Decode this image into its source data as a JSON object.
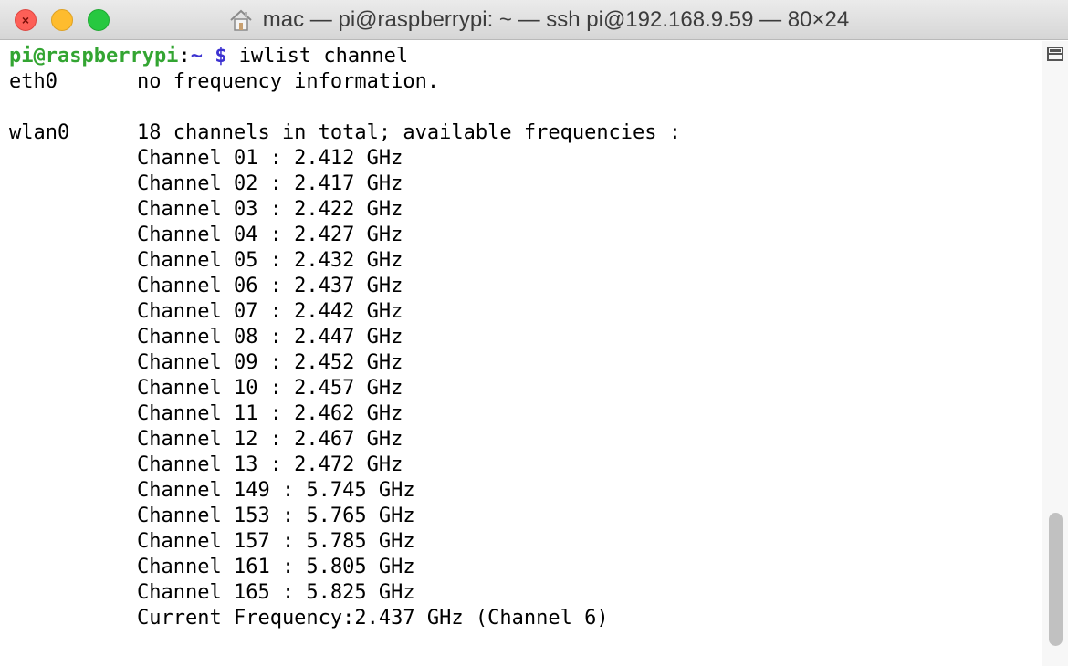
{
  "window": {
    "title": "mac — pi@raspberrypi: ~ — ssh pi@192.168.9.59 — 80×24",
    "buttons": [
      "close",
      "minimize",
      "zoom"
    ],
    "title_icon": "home-icon"
  },
  "prompt": {
    "user_host": "pi@raspberrypi",
    "separator": ":",
    "path": "~",
    "symbol": "$",
    "command": "iwlist channel"
  },
  "output": {
    "eth0": {
      "iface": "eth0",
      "message": "no frequency information."
    },
    "wlan0": {
      "iface": "wlan0",
      "summary": "18 channels in total; available frequencies :"
    },
    "channels": [
      "Channel 01 : 2.412 GHz",
      "Channel 02 : 2.417 GHz",
      "Channel 03 : 2.422 GHz",
      "Channel 04 : 2.427 GHz",
      "Channel 05 : 2.432 GHz",
      "Channel 06 : 2.437 GHz",
      "Channel 07 : 2.442 GHz",
      "Channel 08 : 2.447 GHz",
      "Channel 09 : 2.452 GHz",
      "Channel 10 : 2.457 GHz",
      "Channel 11 : 2.462 GHz",
      "Channel 12 : 2.467 GHz",
      "Channel 13 : 2.472 GHz",
      "Channel 149 : 5.745 GHz",
      "Channel 153 : 5.765 GHz",
      "Channel 157 : 5.785 GHz",
      "Channel 161 : 5.805 GHz",
      "Channel 165 : 5.825 GHz"
    ],
    "current": "Current Frequency:2.437 GHz (Channel 6)"
  },
  "colors": {
    "prompt_user": "#33a532",
    "prompt_path": "#3c32d1",
    "close": "#fd5f57",
    "minimize": "#febc2e",
    "zoom": "#27c840"
  },
  "scrollbar": {
    "position_fraction": 0.78
  }
}
